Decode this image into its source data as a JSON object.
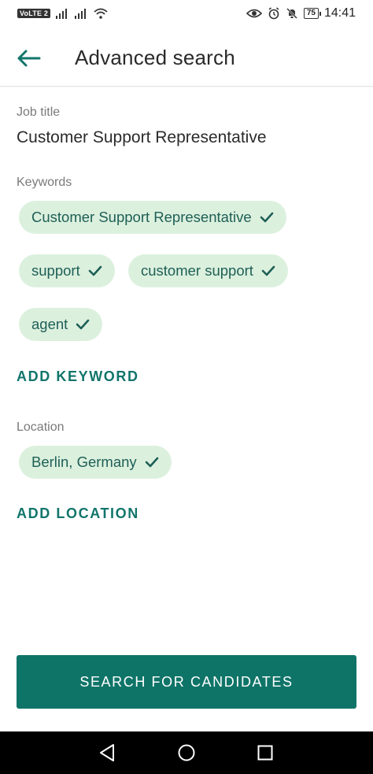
{
  "status_bar": {
    "volte": "VoLTE 2",
    "battery": "75",
    "time": "14:41"
  },
  "app_bar": {
    "title": "Advanced search",
    "back_icon": "arrow-left-icon"
  },
  "job_title": {
    "label": "Job title",
    "value": "Customer Support Representative"
  },
  "keywords": {
    "label": "Keywords",
    "chips": [
      "Customer Support Representative",
      "support",
      "customer support",
      "agent"
    ],
    "add_label": "ADD KEYWORD"
  },
  "location": {
    "label": "Location",
    "chips": [
      "Berlin, Germany"
    ],
    "add_label": "ADD LOCATION"
  },
  "search_button": "SEARCH FOR CANDIDATES",
  "colors": {
    "accent": "#0f7468",
    "chip_bg": "#dcf0de",
    "chip_text": "#1e5f56"
  }
}
